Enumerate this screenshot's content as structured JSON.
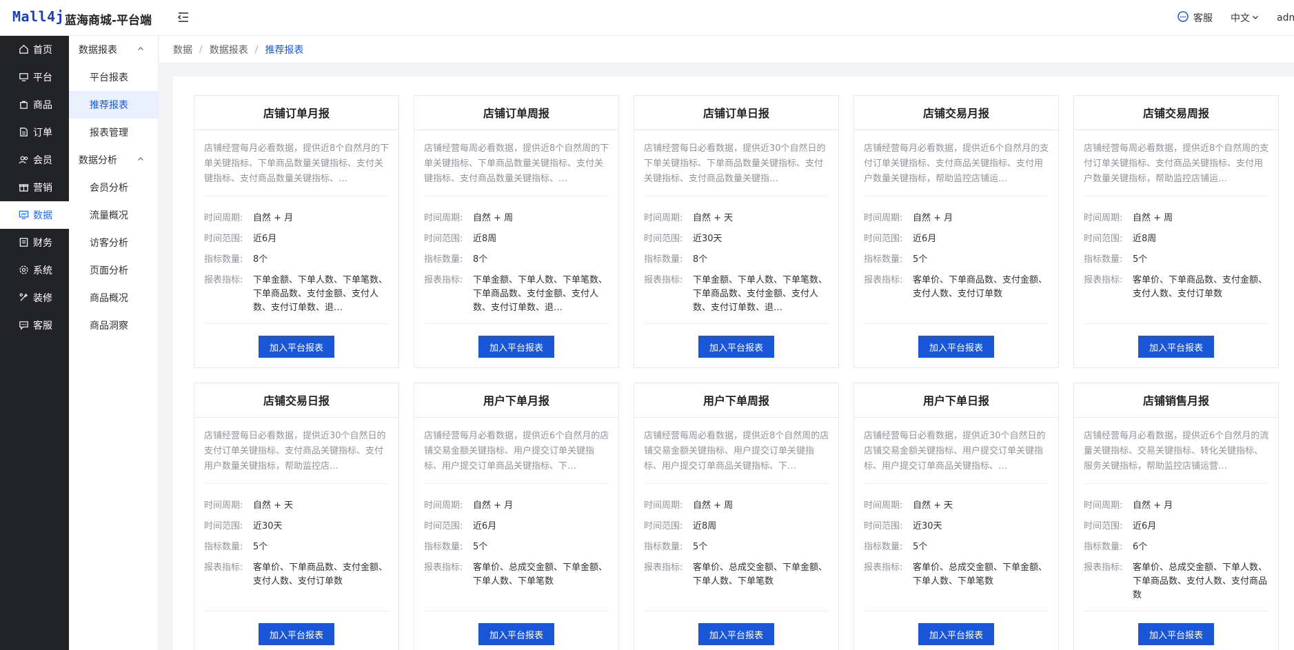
{
  "header": {
    "logo": "Mall4j",
    "title": "蓝海商城-平台端",
    "service_label": "客服",
    "lang_label": "中文",
    "user_label": "admi"
  },
  "nav1": [
    {
      "label": "首页",
      "icon": "home-icon"
    },
    {
      "label": "平台",
      "icon": "monitor-icon"
    },
    {
      "label": "商品",
      "icon": "bag-icon"
    },
    {
      "label": "订单",
      "icon": "document-icon"
    },
    {
      "label": "会员",
      "icon": "users-icon"
    },
    {
      "label": "营销",
      "icon": "gift-icon"
    },
    {
      "label": "数据",
      "icon": "chart-icon",
      "active": true
    },
    {
      "label": "财务",
      "icon": "finance-icon"
    },
    {
      "label": "系统",
      "icon": "gear-icon"
    },
    {
      "label": "装修",
      "icon": "decor-icon"
    },
    {
      "label": "客服",
      "icon": "chat-icon"
    }
  ],
  "nav2": {
    "group1": "数据报表",
    "group1_items": [
      "平台报表",
      "推荐报表",
      "报表管理"
    ],
    "group2": "数据分析",
    "group2_items": [
      "会员分析",
      "流量概况",
      "访客分析",
      "页面分析",
      "商品概况",
      "商品洞察"
    ]
  },
  "breadcrumb": [
    "数据",
    "数据报表",
    "推荐报表"
  ],
  "labels": {
    "period": "时间周期:",
    "range": "时间范围:",
    "count": "指标数量:",
    "indicators": "报表指标:",
    "button": "加入平台报表"
  },
  "cards": [
    {
      "title": "店铺订单月报",
      "desc": "店铺经营每月必看数据，提供近8个自然月的下单关键指标、下单商品数量关键指标、支付关键指标、支付商品数量关键指标、…",
      "period": "自然 + 月",
      "range": "近6月",
      "count": "8个",
      "indicators": "下单金额、下单人数、下单笔数、下单商品数、支付金额、支付人数、支付订单数、退…"
    },
    {
      "title": "店铺订单周报",
      "desc": "店铺经营每周必看数据，提供近8个自然周的下单关键指标、下单商品数量关键指标、支付关键指标、支付商品数量关键指标、…",
      "period": "自然 + 周",
      "range": "近8周",
      "count": "8个",
      "indicators": "下单金额、下单人数、下单笔数、下单商品数、支付金额、支付人数、支付订单数、退…"
    },
    {
      "title": "店铺订单日报",
      "desc": "店铺经营每日必看数据，提供近30个自然日的下单关键指标、下单商品数量关键指标、支付关键指标、支付商品数量关键指…",
      "period": "自然 + 天",
      "range": "近30天",
      "count": "8个",
      "indicators": "下单金额、下单人数、下单笔数、下单商品数、支付金额、支付人数、支付订单数、退…"
    },
    {
      "title": "店铺交易月报",
      "desc": "店铺经营每月必看数据，提供近6个自然月的支付订单关键指标、支付商品关键指标、支付用户数量关键指标，帮助监控店铺运…",
      "period": "自然 + 月",
      "range": "近6月",
      "count": "5个",
      "indicators": "客单价、下单商品数、支付金额、支付人数、支付订单数"
    },
    {
      "title": "店铺交易周报",
      "desc": "店铺经营每周必看数据，提供近8个自然周的支付订单关键指标、支付商品关键指标、支付用户数量关键指标，帮助监控店铺运…",
      "period": "自然 + 周",
      "range": "近8周",
      "count": "5个",
      "indicators": "客单价、下单商品数、支付金额、支付人数、支付订单数"
    },
    {
      "title": "店铺交易日报",
      "desc": "店铺经营每日必看数据，提供近30个自然日的支付订单关键指标、支付商品关键指标、支付用户数量关键指标，帮助监控店…",
      "period": "自然 + 天",
      "range": "近30天",
      "count": "5个",
      "indicators": "客单价、下单商品数、支付金额、支付人数、支付订单数"
    },
    {
      "title": "用户下单月报",
      "desc": "店铺经营每月必看数据，提供近6个自然月的店铺交易金额关键指标、用户提交订单关键指标、用户提交订单商品关键指标、下…",
      "period": "自然 + 月",
      "range": "近6月",
      "count": "5个",
      "indicators": "客单价、总成交金额、下单金额、下单人数、下单笔数"
    },
    {
      "title": "用户下单周报",
      "desc": "店铺经营每周必看数据，提供近8个自然周的店铺交易金额关键指标、用户提交订单关键指标、用户提交订单商品关键指标、下…",
      "period": "自然 + 周",
      "range": "近8周",
      "count": "5个",
      "indicators": "客单价、总成交金额、下单金额、下单人数、下单笔数"
    },
    {
      "title": "用户下单日报",
      "desc": "店铺经营每日必看数据，提供近30个自然日的店铺交易金额关键指标、用户提交订单关键指标、用户提交订单商品关键指标、…",
      "period": "自然 + 天",
      "range": "近30天",
      "count": "5个",
      "indicators": "客单价、总成交金额、下单金额、下单人数、下单笔数"
    },
    {
      "title": "店铺销售月报",
      "desc": "店铺经营每月必看数据，提供近6个自然月的流量关键指标、交易关键指标、转化关键指标、服务关键指标，帮助监控店铺运营…",
      "period": "自然 + 月",
      "range": "近6月",
      "count": "6个",
      "indicators": "客单价、总成交金额、下单人数、下单商品数、支付人数、支付商品数"
    }
  ]
}
